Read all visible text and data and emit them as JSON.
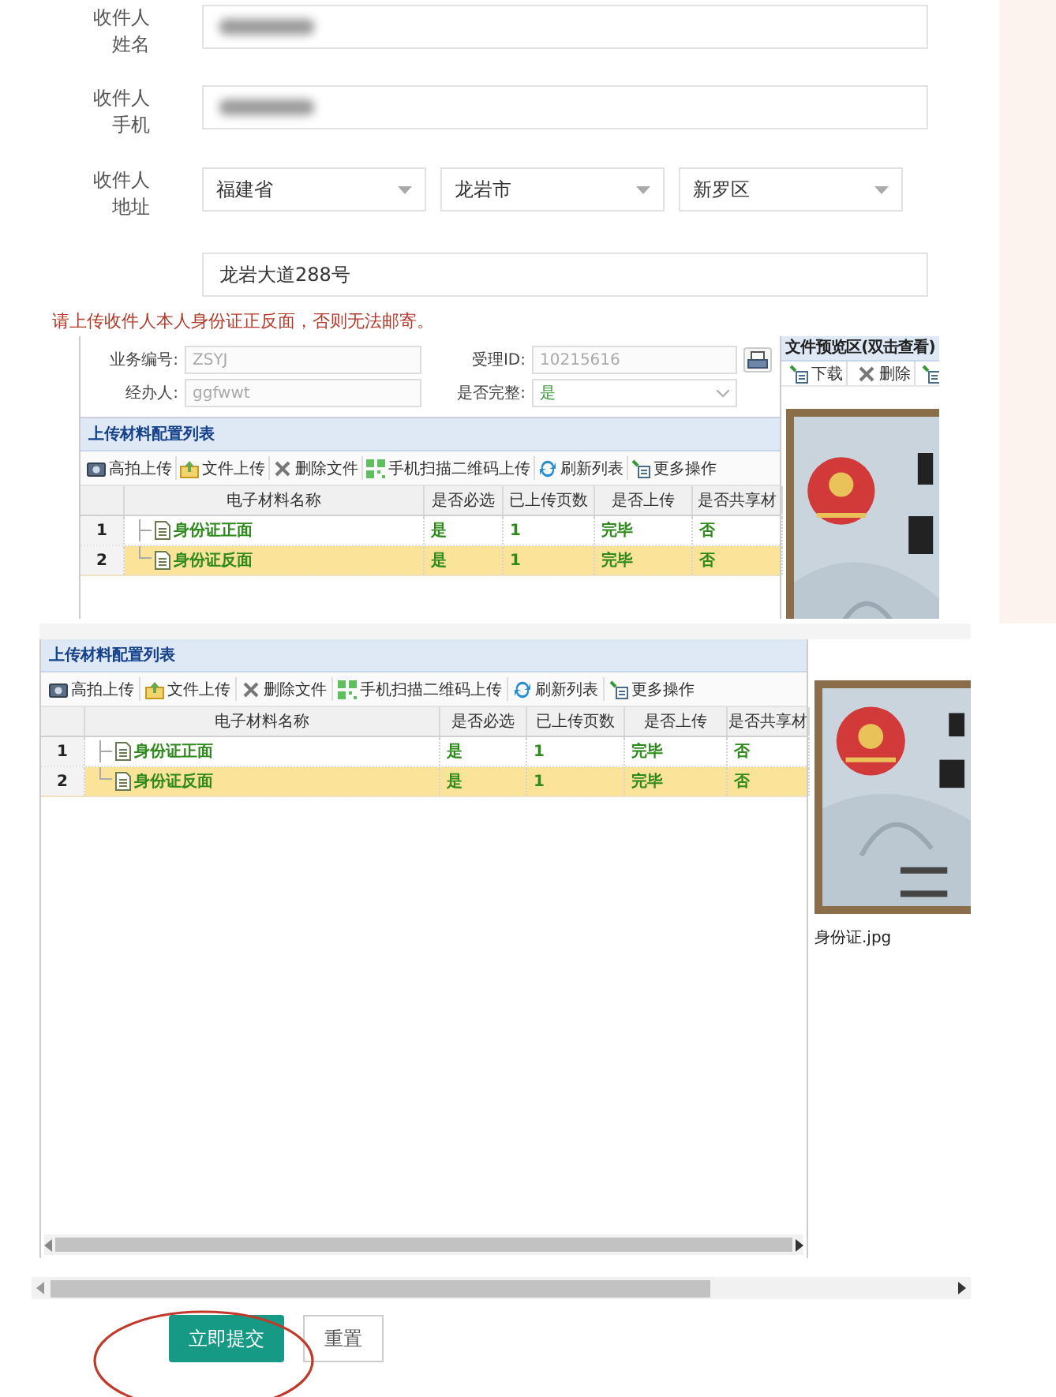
{
  "form": {
    "fields": [
      {
        "kind": "redacted",
        "label": [
          "收件人",
          "姓名"
        ]
      },
      {
        "kind": "redacted",
        "label": [
          "收件人",
          "手机"
        ]
      },
      {
        "kind": "address",
        "label": [
          "收件人",
          "地址"
        ],
        "selects": [
          "福建省",
          "龙岩市",
          "新罗区"
        ]
      },
      {
        "kind": "text",
        "value": "龙岩大道288号"
      }
    ],
    "notice": "请上传收件人本人身份证正反面，否则无法邮寄。"
  },
  "upper_panel": {
    "info_fields": [
      {
        "kind": "text",
        "label": "业务编号:",
        "value": "ZSYJ"
      },
      {
        "kind": "print",
        "label": "受理ID:",
        "value": "10215616"
      },
      {
        "kind": "text",
        "label": "经办人:",
        "value": "ggfwwt"
      },
      {
        "kind": "select",
        "label": "是否完整:",
        "value": "是"
      }
    ],
    "list_title": "上传材料配置列表",
    "toolbar": [
      "高拍上传",
      "文件上传",
      "删除文件",
      "手机扫描二维码上传",
      "刷新列表",
      "更多操作"
    ],
    "table": {
      "columns": [
        "电子材料名称",
        "是否必选",
        "已上传页数",
        "是否上传",
        "是否共享材"
      ],
      "rows": [
        {
          "index": "1",
          "name": "身份证正面",
          "required": "是",
          "pages": "1",
          "uploaded": "完毕",
          "shared": "否",
          "selected": false
        },
        {
          "index": "2",
          "name": "身份证反面",
          "required": "是",
          "pages": "1",
          "uploaded": "完毕",
          "shared": "否",
          "selected": true
        }
      ]
    },
    "preview": {
      "title": "文件预览区(双击查看)",
      "toolbar": [
        "下载",
        "删除"
      ],
      "image": {
        "kind": "picture"
      }
    }
  },
  "lower_panel": {
    "list_title": "上传材料配置列表",
    "toolbar": [
      "高拍上传",
      "文件上传",
      "删除文件",
      "手机扫描二维码上传",
      "刷新列表",
      "更多操作"
    ],
    "table": {
      "columns": [
        "电子材料名称",
        "是否必选",
        "已上传页数",
        "是否上传",
        "是否共享材"
      ],
      "rows": [
        {
          "index": "1",
          "name": "身份证正面",
          "required": "是",
          "pages": "1",
          "uploaded": "完毕",
          "shared": "否",
          "selected": false
        },
        {
          "index": "2",
          "name": "身份证反面",
          "required": "是",
          "pages": "1",
          "uploaded": "完毕",
          "shared": "否",
          "selected": true
        }
      ]
    },
    "preview": {
      "image": {
        "kind": "picture"
      },
      "caption": "身份证.jpg"
    }
  },
  "actions": [
    {
      "kind": "primary",
      "label": "立即提交",
      "circled": true
    },
    {
      "kind": "secondary",
      "label": "重置",
      "circled": false
    }
  ]
}
